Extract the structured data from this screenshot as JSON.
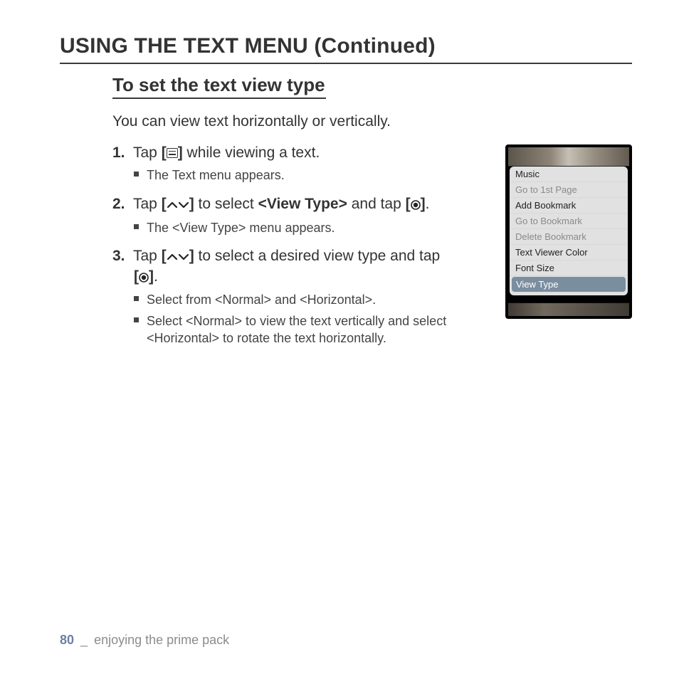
{
  "page": {
    "title": "USING THE TEXT MENU (Continued)",
    "section_title": "To set the text view type",
    "intro": "You can view text horizontally or vertically."
  },
  "steps": {
    "s1": {
      "num": "1.",
      "pre": "Tap ",
      "post": " while viewing a text.",
      "sub1": "The Text menu appears."
    },
    "s2": {
      "num": "2.",
      "pre": "Tap ",
      "mid1": " to select ",
      "view_type": "<View Type>",
      "mid2": " and tap ",
      "post": ".",
      "sub1": "The <View Type> menu appears."
    },
    "s3": {
      "num": "3.",
      "pre": "Tap ",
      "mid": " to select a desired view type and tap ",
      "post": ".",
      "sub1": "Select from <Normal> and <Horizontal>.",
      "sub2": "Select <Normal> to view the text vertically and select <Horizontal> to rotate the text horizontally."
    }
  },
  "brackets": {
    "open": "[",
    "close": "]"
  },
  "device_menu": {
    "items": {
      "i0": "Music",
      "i1": "Go to 1st Page",
      "i2": "Add Bookmark",
      "i3": "Go to Bookmark",
      "i4": "Delete Bookmark",
      "i5": "Text Viewer Color",
      "i6": "Font Size",
      "i7": "View Type"
    }
  },
  "footer": {
    "page_number": "80",
    "underscore": "_",
    "chapter": " enjoying the prime pack"
  }
}
